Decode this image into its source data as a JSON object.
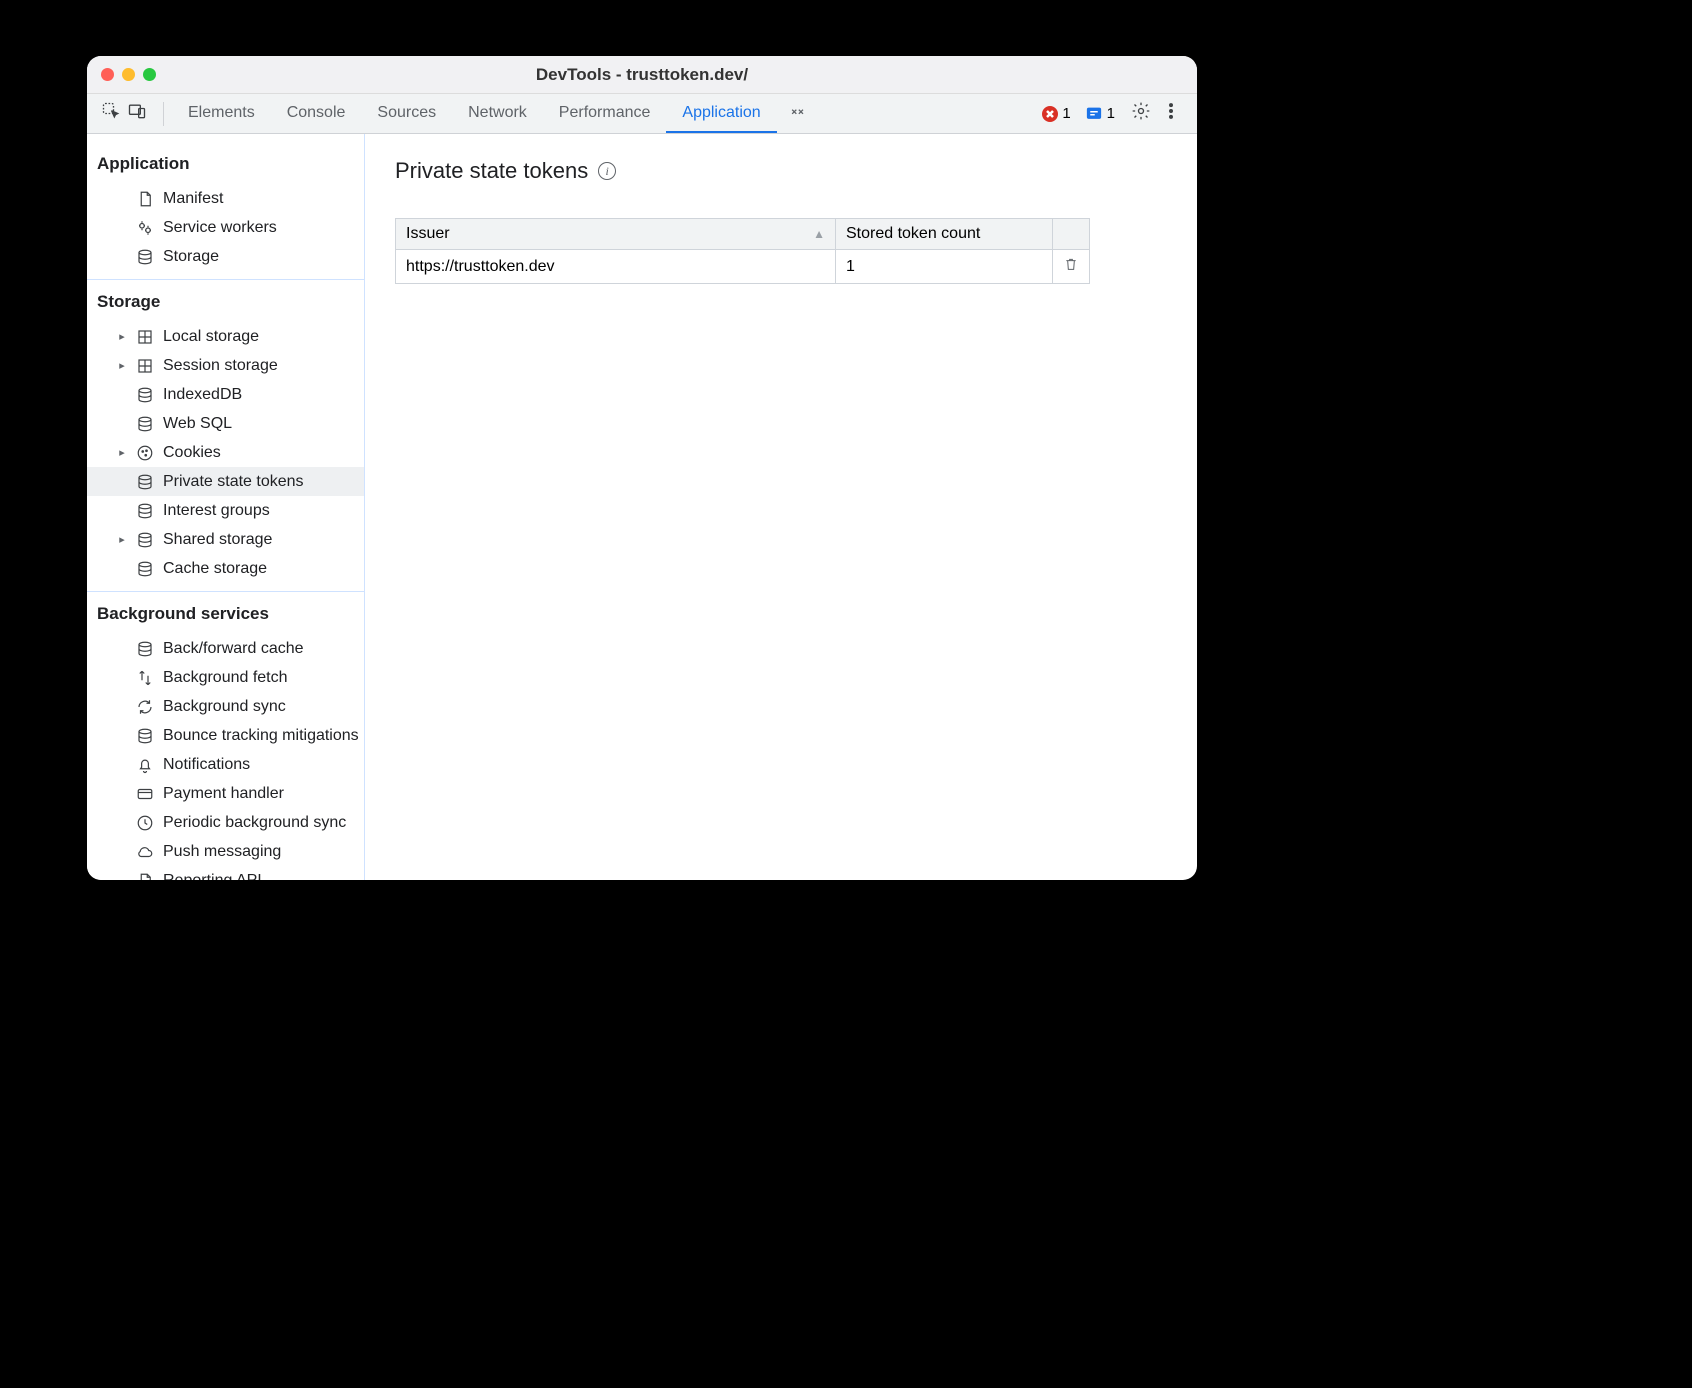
{
  "window": {
    "title": "DevTools - trusttoken.dev/"
  },
  "toolbar": {
    "tabs": [
      "Elements",
      "Console",
      "Sources",
      "Network",
      "Performance",
      "Application"
    ],
    "active_tab": "Application",
    "error_count": "1",
    "info_count": "1"
  },
  "sidebar": {
    "sections": [
      {
        "title": "Application",
        "items": [
          {
            "label": "Manifest",
            "icon": "document",
            "expandable": false
          },
          {
            "label": "Service workers",
            "icon": "gears",
            "expandable": false
          },
          {
            "label": "Storage",
            "icon": "database",
            "expandable": false
          }
        ]
      },
      {
        "title": "Storage",
        "items": [
          {
            "label": "Local storage",
            "icon": "grid",
            "expandable": true
          },
          {
            "label": "Session storage",
            "icon": "grid",
            "expandable": true
          },
          {
            "label": "IndexedDB",
            "icon": "database",
            "expandable": false
          },
          {
            "label": "Web SQL",
            "icon": "database",
            "expandable": false
          },
          {
            "label": "Cookies",
            "icon": "cookie",
            "expandable": true
          },
          {
            "label": "Private state tokens",
            "icon": "database",
            "expandable": false,
            "selected": true
          },
          {
            "label": "Interest groups",
            "icon": "database",
            "expandable": false
          },
          {
            "label": "Shared storage",
            "icon": "database",
            "expandable": true
          },
          {
            "label": "Cache storage",
            "icon": "database",
            "expandable": false
          }
        ]
      },
      {
        "title": "Background services",
        "items": [
          {
            "label": "Back/forward cache",
            "icon": "database",
            "expandable": false
          },
          {
            "label": "Background fetch",
            "icon": "arrows",
            "expandable": false
          },
          {
            "label": "Background sync",
            "icon": "sync",
            "expandable": false
          },
          {
            "label": "Bounce tracking mitigations",
            "icon": "database",
            "expandable": false
          },
          {
            "label": "Notifications",
            "icon": "bell",
            "expandable": false
          },
          {
            "label": "Payment handler",
            "icon": "card",
            "expandable": false
          },
          {
            "label": "Periodic background sync",
            "icon": "clock",
            "expandable": false
          },
          {
            "label": "Push messaging",
            "icon": "cloud",
            "expandable": false
          },
          {
            "label": "Reporting API",
            "icon": "document",
            "expandable": false
          }
        ]
      }
    ]
  },
  "panel": {
    "heading": "Private state tokens",
    "columns": [
      "Issuer",
      "Stored token count"
    ],
    "rows": [
      {
        "issuer": "https://trusttoken.dev",
        "count": "1"
      }
    ]
  }
}
